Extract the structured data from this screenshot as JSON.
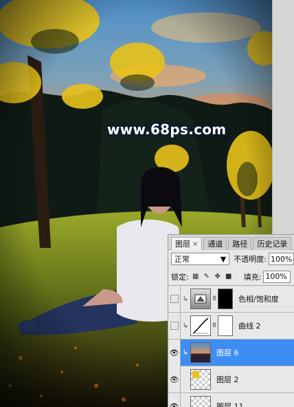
{
  "watermark": "www.68ps.com",
  "layers_panel": {
    "tabs": [
      {
        "label": "图层",
        "active": true,
        "close": "×"
      },
      {
        "label": "通道",
        "active": false
      },
      {
        "label": "路径",
        "active": false
      },
      {
        "label": "历史记录",
        "active": false
      }
    ],
    "blend_mode": "正常",
    "opacity_label": "不透明度:",
    "opacity_value": "100%",
    "lock_label": "锁定:",
    "fill_label": "填充:",
    "fill_value": "100%",
    "layers": [
      {
        "name": "色相/饱和度",
        "visible": false,
        "clipped": true,
        "type": "adjustment-hue"
      },
      {
        "name": "曲线 2",
        "visible": false,
        "clipped": true,
        "type": "adjustment-curves"
      },
      {
        "name": "图层 6",
        "visible": true,
        "clipped": true,
        "selected": true,
        "type": "image"
      },
      {
        "name": "图层 2",
        "visible": true,
        "clipped": false,
        "type": "pixel"
      },
      {
        "name": "图层 11",
        "visible": true,
        "clipped": false,
        "type": "pixel"
      }
    ]
  },
  "colors": {
    "selection": "#3d8ef2",
    "panel_bg": "#e8e8e8",
    "foliage_yellow": "#e8c21a"
  }
}
